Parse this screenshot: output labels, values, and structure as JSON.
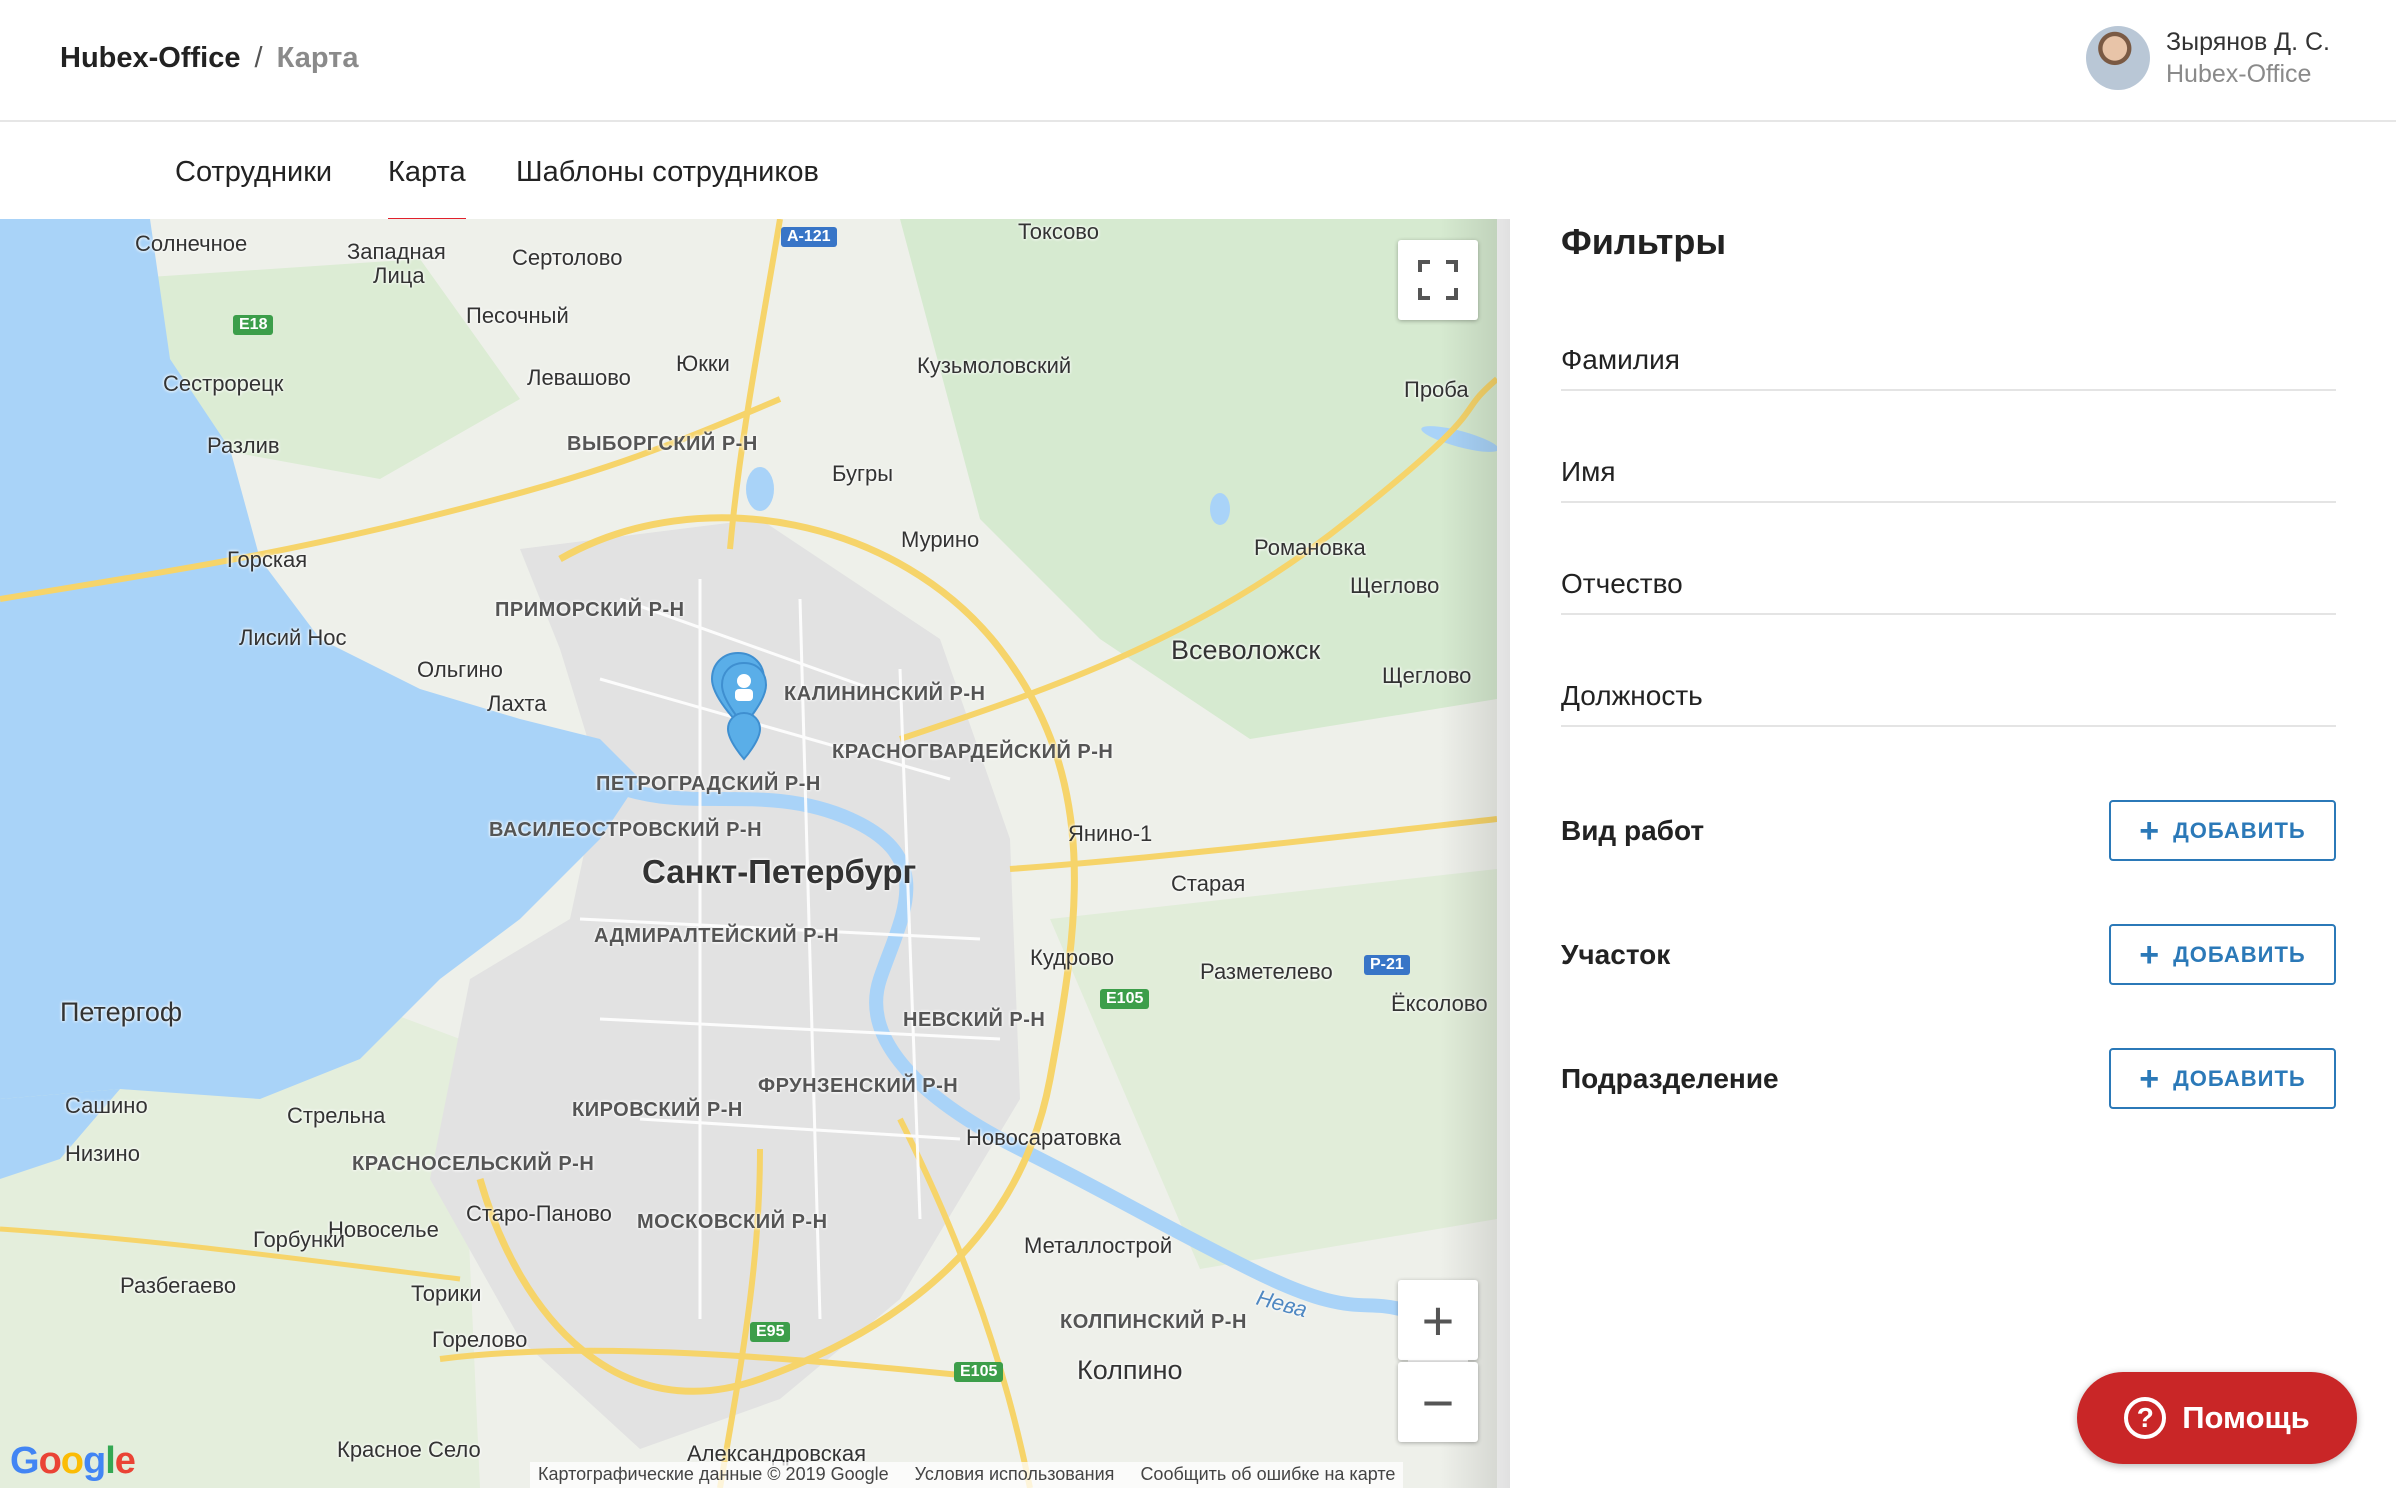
{
  "header": {
    "app_name": "Hubex-Office",
    "separator": "/",
    "page_name": "Карта",
    "user": {
      "name": "Зырянов Д. С.",
      "org": "Hubex-Office"
    }
  },
  "tabs": [
    {
      "label": "Сотрудники",
      "active": false
    },
    {
      "label": "Карта",
      "active": true
    },
    {
      "label": "Шаблоны сотрудников",
      "active": false
    }
  ],
  "map": {
    "labels": [
      "Солнечное",
      "Западная",
      "Лица",
      "Сертолово",
      "Песочный",
      "Сестрорецк",
      "Левашово",
      "Юкки",
      "Кузьмоловский",
      "Токсово",
      "Разлив",
      "Бугры",
      "Проба",
      "Горская",
      "Мурино",
      "Романовка",
      "Щеглово",
      "Лисий Нос",
      "Ольгино",
      "Лахта",
      "Щеглово",
      "Янино-1",
      "Старая",
      "Кудрово",
      "Разметелево",
      "Ёксолово",
      "Петергоф",
      "Сашино",
      "Стрельна",
      "Низино",
      "Новосаратовка",
      "Старо-Паново",
      "Новоселье",
      "Горбунки",
      "Металлострой",
      "Разбегаево",
      "Торики",
      "Горелово",
      "Колпино",
      "Красное Село",
      "Александровская",
      "Нева"
    ],
    "districts": [
      "ВЫБОРГСКИЙ Р-Н",
      "ПРИМОРСКИЙ Р-Н",
      "КАЛИНИНСКИЙ Р-Н",
      "КРАСНОГВАРДЕЙСКИЙ Р-Н",
      "ПЕТРОГРАДСКИЙ Р-Н",
      "ВАСИЛЕОСТРОВСКИЙ Р-Н",
      "АДМИРАЛТЕЙСКИЙ Р-Н",
      "НЕВСКИЙ Р-Н",
      "ФРУНЗЕНСКИЙ Р-Н",
      "КИРОВСКИЙ Р-Н",
      "КРАСНОСЕЛЬСКИЙ Р-Н",
      "МОСКОВСКИЙ Р-Н",
      "КОЛПИНСКИЙ Р-Н"
    ],
    "city": "Санкт-Петербург",
    "big_labels": [
      "Всеволожск"
    ],
    "shields": [
      "A-121",
      "E18",
      "P-21",
      "E105",
      "E95",
      "E105"
    ],
    "logo": "Google",
    "attribution": {
      "data": "Картографические данные © 2019 Google",
      "terms": "Условия использования",
      "report": "Сообщить об ошибке на карте"
    },
    "zoom_in": "+",
    "zoom_out": "−",
    "colors": {
      "water": "#a9d3f8",
      "land": "#eef0ea",
      "city": "#e2e2e2",
      "road": "#f6d46a",
      "park": "#cfe8c2",
      "marker": "#5aaee8"
    }
  },
  "filters": {
    "title": "Фильтры",
    "fields": [
      {
        "placeholder": "Фамилия"
      },
      {
        "placeholder": "Имя"
      },
      {
        "placeholder": "Отчество"
      },
      {
        "placeholder": "Должность"
      }
    ],
    "groups": [
      {
        "label": "Вид работ",
        "button": "ДОБАВИТЬ"
      },
      {
        "label": "Участок",
        "button": "ДОБАВИТЬ"
      },
      {
        "label": "Подразделение",
        "button": "ДОБАВИТЬ"
      }
    ]
  },
  "help": {
    "label": "Помощь",
    "icon": "?"
  },
  "colors": {
    "accent_red": "#e1212c",
    "button_blue": "#2b79b8",
    "help_red": "#c92627"
  }
}
